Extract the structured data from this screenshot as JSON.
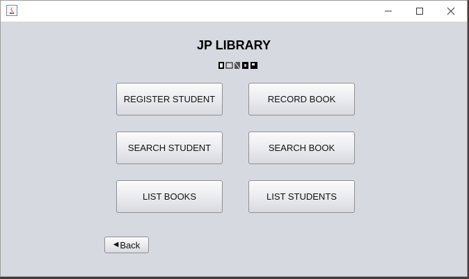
{
  "window": {
    "icon": "java-app-icon",
    "controls": [
      "minimize-icon",
      "maximize-icon",
      "close-icon"
    ]
  },
  "main": {
    "title": "JP LIBRARY",
    "buttons": [
      {
        "label": "REGISTER STUDENT"
      },
      {
        "label": "RECORD BOOK"
      },
      {
        "label": "SEARCH STUDENT"
      },
      {
        "label": "SEARCH BOOK"
      },
      {
        "label": "LIST BOOKS"
      },
      {
        "label": "LIST STUDENTS"
      }
    ],
    "back": {
      "label": "Back",
      "icon": "arrow-left-icon"
    }
  }
}
